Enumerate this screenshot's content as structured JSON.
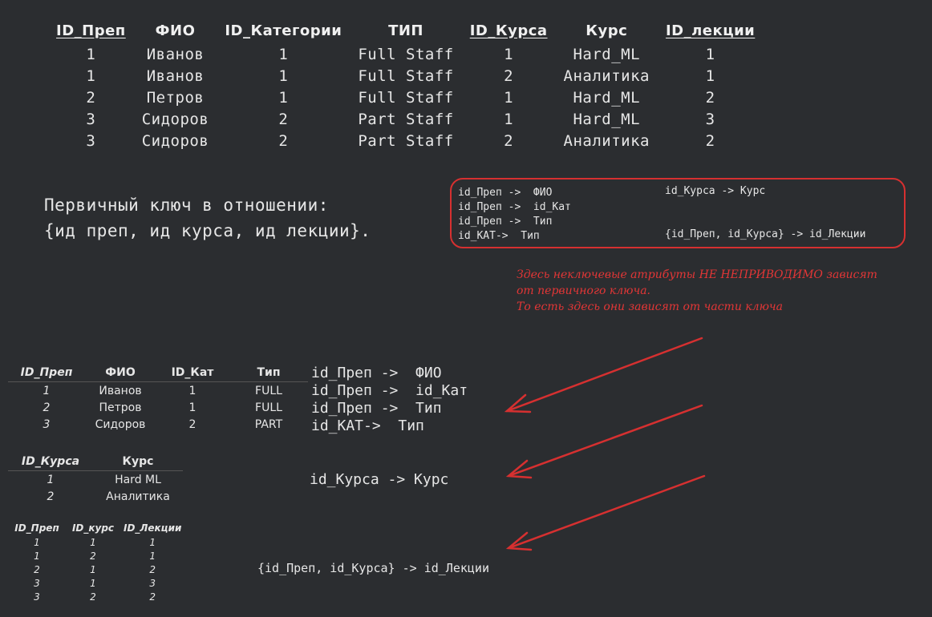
{
  "main_table": {
    "headers": [
      {
        "label": "ID_Преп",
        "key": true
      },
      {
        "label": "ФИО",
        "key": false
      },
      {
        "label": "ID_Категории",
        "key": false
      },
      {
        "label": "ТИП",
        "key": false
      },
      {
        "label": "ID_Курса",
        "key": true
      },
      {
        "label": "Курс",
        "key": false
      },
      {
        "label": "ID_лекции",
        "key": true
      }
    ],
    "rows": [
      [
        "1",
        "Иванов",
        "1",
        "Full Staff",
        "1",
        "Hard_ML",
        "1"
      ],
      [
        "1",
        "Иванов",
        "1",
        "Full Staff",
        "2",
        "Аналитика",
        "1"
      ],
      [
        "2",
        "Петров",
        "1",
        "Full Staff",
        "1",
        "Hard_ML",
        "2"
      ],
      [
        "3",
        "Сидоров",
        "2",
        "Part Staff",
        "1",
        "Hard_ML",
        "3"
      ],
      [
        "3",
        "Сидоров",
        "2",
        "Part Staff",
        "2",
        "Аналитика",
        "2"
      ]
    ]
  },
  "primary_key": {
    "line1": "Первичный ключ в отношении:",
    "line2": "{ид преп, ид курса, ид лекции}."
  },
  "fd_box": {
    "left_lines": [
      "id_Преп ->  ФИО",
      "id_Преп ->  id_Кат",
      "id_Преп ->  Тип",
      "id_КАТ->  Тип"
    ],
    "right_top": "id_Курса -> Курс",
    "right_bottom": "{id_Преп, id_Курса} -> id_Лекции"
  },
  "note": {
    "lines": [
      "Здесь неключевые атрибуты НЕ НЕПРИВОДИМО зависят",
      "от первичного ключа.",
      "То есть здесь они зависят от части ключа"
    ],
    "color": "#e23636"
  },
  "table_prep": {
    "headers": [
      "ID_Преп",
      "ФИО",
      "ID_Кат",
      "Тип"
    ],
    "rows": [
      [
        "1",
        "Иванов",
        "1",
        "FULL"
      ],
      [
        "2",
        "Петров",
        "1",
        "FULL"
      ],
      [
        "3",
        "Сидоров",
        "2",
        "PART"
      ]
    ]
  },
  "table_curs": {
    "headers": [
      "ID_Курса",
      "Курс"
    ],
    "rows": [
      [
        "1",
        "Hard ML"
      ],
      [
        "2",
        "Аналитика"
      ]
    ]
  },
  "table_lect": {
    "headers": [
      "ID_Преп",
      "ID_курс",
      "ID_Лекции"
    ],
    "rows": [
      [
        "1",
        "1",
        "1"
      ],
      [
        "1",
        "2",
        "1"
      ],
      [
        "2",
        "1",
        "2"
      ],
      [
        "3",
        "1",
        "3"
      ],
      [
        "3",
        "2",
        "2"
      ]
    ]
  },
  "fd_prep": [
    "id_Преп ->  ФИО",
    "id_Преп ->  id_Кат",
    "id_Преп ->  Тип",
    "id_КАТ->  Тип"
  ],
  "fd_curs": "id_Курса -> Курс",
  "fd_lect": "{id_Преп, id_Курса} -> id_Лекции",
  "accent_color": "#d63030"
}
